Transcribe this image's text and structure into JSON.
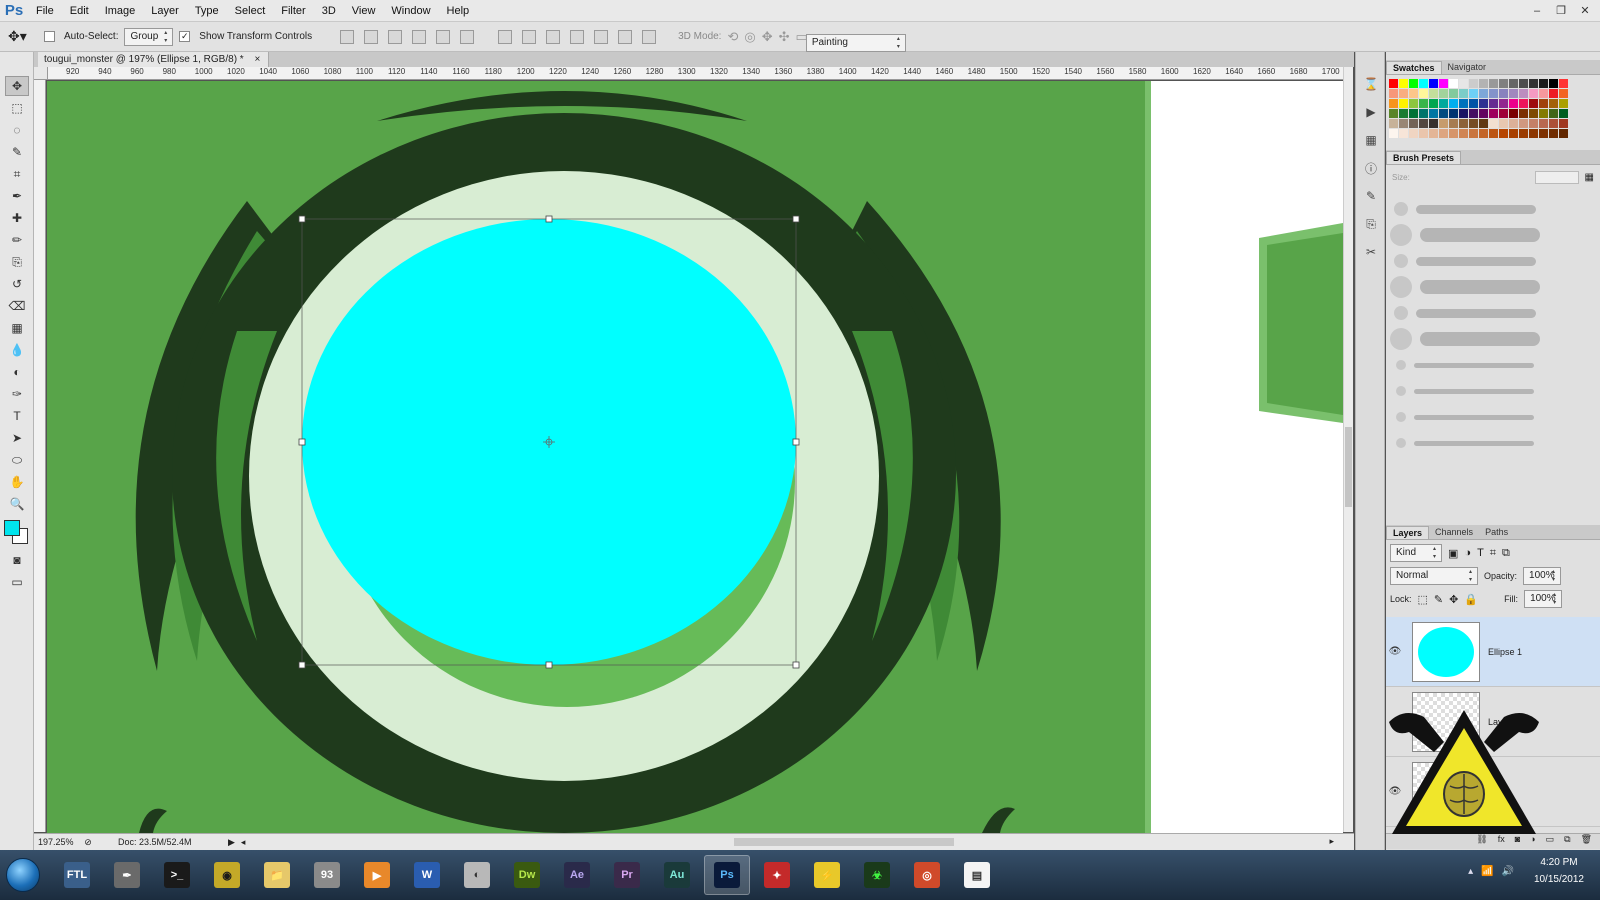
{
  "app": {
    "logo": "Ps",
    "menu": [
      "File",
      "Edit",
      "Image",
      "Layer",
      "Type",
      "Select",
      "Filter",
      "3D",
      "View",
      "Window",
      "Help"
    ],
    "window_controls": {
      "minimize": "–",
      "restore": "❐",
      "close": "✕"
    }
  },
  "options_bar": {
    "auto_select_label": "Auto-Select:",
    "auto_select_checked": false,
    "auto_select_target": "Group",
    "show_transform_label": "Show Transform Controls",
    "show_transform_checked": true,
    "mode_3d_label": "3D Mode:",
    "workspace": "Painting"
  },
  "document": {
    "tab_title": "tougui_monster @ 197% (Ellipse 1, RGB/8) *",
    "tab_close": "×",
    "zoom": "197.25%",
    "doc_size": "Doc: 23.5M/52.4M",
    "ruler_labels": [
      "920",
      "940",
      "960",
      "980",
      "1000",
      "1020",
      "1040",
      "1060",
      "1080",
      "1100",
      "1120",
      "1140",
      "1160",
      "1180",
      "1200",
      "1220",
      "1240",
      "1260",
      "1280",
      "1300",
      "1320",
      "1340",
      "1360",
      "1380",
      "1400",
      "1420",
      "1440",
      "1460",
      "1480",
      "1500",
      "1520",
      "1540",
      "1560",
      "1580",
      "1600",
      "1620",
      "1640",
      "1660",
      "1680",
      "1700"
    ]
  },
  "tools": [
    "move-tool",
    "marquee-tool",
    "lasso-tool",
    "quick-select-tool",
    "crop-tool",
    "eyedropper-tool",
    "healing-tool",
    "brush-tool",
    "stamp-tool",
    "history-brush-tool",
    "eraser-tool",
    "gradient-tool",
    "blur-tool",
    "dodge-tool",
    "pen-tool",
    "type-tool",
    "path-select-tool",
    "shape-tool",
    "hand-tool",
    "zoom-tool"
  ],
  "tool_glyphs": [
    "✥",
    "⬚",
    "◌",
    "✎",
    "⌗",
    "✒",
    "✚",
    "✏",
    "⎘",
    "↺",
    "⌫",
    "▦",
    "💧",
    "◐",
    "✑",
    "T",
    "➤",
    "⬭",
    "✋",
    "🔍"
  ],
  "colors": {
    "foreground": "#00e5ee",
    "background": "#ffffff",
    "canvas_green": "#58a449",
    "dark_green": "#1f3a1c",
    "mid_green": "#3f8a36",
    "light_green": "#d8edd3",
    "shadow_green": "#67bb58",
    "cyan": "#00ffff"
  },
  "panels": {
    "swatches_tabs": [
      "Swatches",
      "Navigator"
    ],
    "brush_tab": "Brush Presets",
    "brush_size_label": "Size:",
    "layers_tabs": [
      "Layers",
      "Channels",
      "Paths"
    ],
    "kind_label": "Kind",
    "blend_mode": "Normal",
    "opacity_label": "Opacity:",
    "opacity_value": "100%",
    "lock_label": "Lock:",
    "fill_label": "Fill:",
    "fill_value": "100%",
    "layers": [
      {
        "name": "Ellipse 1",
        "selected": true,
        "visible": true
      },
      {
        "name": "Layer 6",
        "selected": false,
        "visible": false
      },
      {
        "name": "",
        "selected": false,
        "visible": true
      }
    ]
  },
  "taskbar": {
    "apps": [
      {
        "name": "FTL",
        "label": "FTL",
        "color": "#3a5f8a",
        "text": "#ffffff"
      },
      {
        "name": "pen",
        "label": "✒",
        "color": "#6a6a6a",
        "text": "#ffffff"
      },
      {
        "name": "terminal",
        "label": ">_",
        "color": "#1a1a1a",
        "text": "#ffffff"
      },
      {
        "name": "wifi",
        "label": "◉",
        "color": "#c4a928",
        "text": "#1a1a1a"
      },
      {
        "name": "explorer",
        "label": "📁",
        "color": "#e6c86a",
        "text": "#333333"
      },
      {
        "name": "calculator",
        "label": "93",
        "color": "#8a8a8a",
        "text": "#ffffff"
      },
      {
        "name": "media",
        "label": "▶",
        "color": "#e8882a",
        "text": "#ffffff"
      },
      {
        "name": "word",
        "label": "W",
        "color": "#2a5db0",
        "text": "#ffffff"
      },
      {
        "name": "globe",
        "label": "◐",
        "color": "#b8b8b8",
        "text": "#333333"
      },
      {
        "name": "dreamweaver",
        "label": "Dw",
        "color": "#3a5a10",
        "text": "#b6e84a"
      },
      {
        "name": "after-effects",
        "label": "Ae",
        "color": "#2a2a4a",
        "text": "#b9a8f0"
      },
      {
        "name": "premiere",
        "label": "Pr",
        "color": "#3a2a4a",
        "text": "#d9a8f0"
      },
      {
        "name": "audition",
        "label": "Au",
        "color": "#1a3a3a",
        "text": "#7fe8d8"
      },
      {
        "name": "photoshop",
        "label": "Ps",
        "color": "#0a1a3a",
        "text": "#5ab8f8"
      },
      {
        "name": "red-app",
        "label": "✦",
        "color": "#c42a2a",
        "text": "#ffffff"
      },
      {
        "name": "yellow-app",
        "label": "⚡",
        "color": "#e8c82a",
        "text": "#333333"
      },
      {
        "name": "razer",
        "label": "☣",
        "color": "#1a3a1a",
        "text": "#44ff44"
      },
      {
        "name": "chrome",
        "label": "◎",
        "color": "#d04a2a",
        "text": "#ffffff"
      },
      {
        "name": "notepad",
        "label": "▤",
        "color": "#f4f4f4",
        "text": "#333333"
      }
    ],
    "time": "4:20 PM",
    "date": "10/15/2012"
  }
}
